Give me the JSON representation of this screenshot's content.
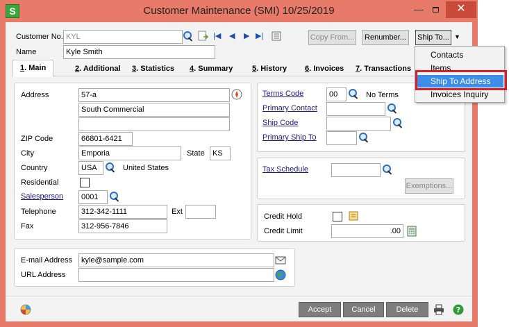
{
  "window": {
    "app_icon": "S",
    "title": "Customer Maintenance (SMI) 10/25/2019",
    "minimize": "—",
    "close": "✕"
  },
  "header": {
    "customer_no_label": "Customer No.",
    "customer_no_value": "KYL",
    "name_label": "Name",
    "name_value": "Kyle Smith",
    "copy_from": "Copy From...",
    "renumber": "Renumber...",
    "ship_to": "Ship To..."
  },
  "tabs": [
    {
      "key": "1",
      "label": ". Main"
    },
    {
      "key": "2",
      "label": ". Additional"
    },
    {
      "key": "3",
      "label": ". Statistics"
    },
    {
      "key": "4",
      "label": ". Summary"
    },
    {
      "key": "5",
      "label": ". History"
    },
    {
      "key": "6",
      "label": ". Invoices"
    },
    {
      "key": "7",
      "label": ". Transactions"
    }
  ],
  "address": {
    "address_label": "Address",
    "line1": "57-a",
    "line2": "South Commercial",
    "line3": "",
    "zip_label": "ZIP Code",
    "zip": "66801-6421",
    "city_label": "City",
    "city": "Emporia",
    "state_label": "State",
    "state": "KS",
    "country_label": "Country",
    "country_code": "USA",
    "country_name": "United States",
    "residential_label": "Residential",
    "salesperson_label": "Salesperson",
    "salesperson": "0001",
    "telephone_label": "Telephone",
    "telephone": "312-342-1111",
    "ext_label": "Ext",
    "ext": "",
    "fax_label": "Fax",
    "fax": "312-956-7846"
  },
  "contact": {
    "email_label": "E-mail Address",
    "email": "kyle@sample.com",
    "url_label": "URL Address",
    "url": ""
  },
  "terms": {
    "terms_code_label": "Terms Code",
    "terms_code": "00",
    "terms_desc": "No Terms",
    "primary_contact_label": "Primary Contact",
    "ship_code_label": "Ship Code",
    "primary_ship_to_label": "Primary Ship To"
  },
  "tax": {
    "tax_schedule_label": "Tax Schedule",
    "exemptions": "Exemptions..."
  },
  "credit": {
    "credit_hold_label": "Credit Hold",
    "credit_limit_label": "Credit Limit",
    "credit_limit": ".00"
  },
  "footer": {
    "accept": "Accept",
    "cancel": "Cancel",
    "delete": "Delete"
  },
  "ship_to_menu": {
    "items": [
      "Contacts",
      "Items",
      "Ship To Address",
      "Invoices Inquiry"
    ],
    "highlighted": "Ship To Address"
  },
  "icons": [
    "search-icon",
    "document-icon",
    "first-record-icon",
    "previous-record-icon",
    "next-record-icon",
    "last-record-icon",
    "list-icon",
    "compass-icon",
    "email-icon",
    "globe-icon",
    "note-icon",
    "calculator-icon",
    "print-icon",
    "help-icon",
    "settings-icon"
  ]
}
